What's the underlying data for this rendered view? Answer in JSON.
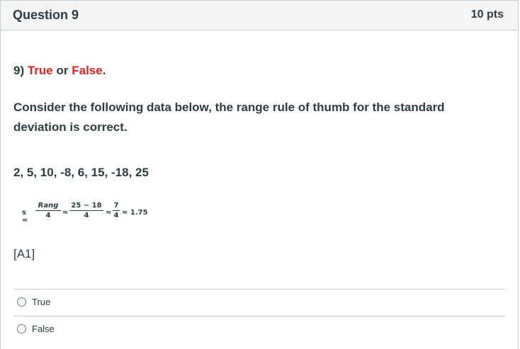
{
  "question": {
    "title": "Question 9",
    "points": "10 pts",
    "prompt_number": "9)",
    "prompt_true": "True",
    "prompt_or": "or",
    "prompt_false": "False",
    "prompt_period": ".",
    "body_line1": "Consider the following data below, the range rule of thumb for the standard",
    "body_line2": "deviation is correct.",
    "data_values": "2, 5, 10, -8, 6, 15, -18, 25",
    "formula": {
      "s": "s ≈",
      "f1_num": "Rang",
      "f1_den": "4",
      "approx1": "≈",
      "f2_num": "25 − 18",
      "f2_den": "4",
      "approx2": "≈",
      "f3_num": "7",
      "f3_den": "4",
      "approx3": "≈ 1.75"
    },
    "tag": "[A1]"
  },
  "answers": [
    {
      "label": "True"
    },
    {
      "label": "False"
    }
  ],
  "colors": {
    "accent_red": "#e61e1e",
    "text": "#2d3b45",
    "border": "#c7cdd1"
  }
}
